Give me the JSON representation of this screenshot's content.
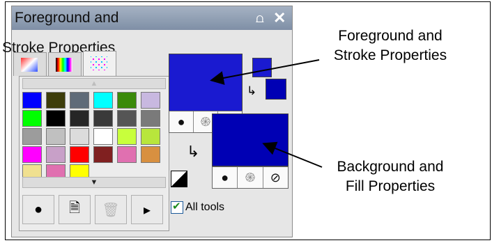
{
  "panel": {
    "title": "Foreground and",
    "title_cont": "Stroke Properties",
    "pin_glyph": "⩍",
    "close_glyph": "✕"
  },
  "palette": {
    "swatches": [
      "#0000ff",
      "#3d3d0a",
      "#5f6b78",
      "#00ffff",
      "#3b8a0a",
      "#c8b8e0",
      "#00ff00",
      "#000000",
      "#262626",
      "#3a3a3a",
      "#555555",
      "#7a7a7a",
      "#9c9c9c",
      "#c0c0c0",
      "#dcdcdc",
      "#ffffff",
      "#c8ff3c",
      "#b8e63c",
      "#ff00ff",
      "#c8a0c8",
      "#ff0000",
      "#802020",
      "#e070b0",
      "#d89040",
      "#f0e090",
      "#e070b0",
      "#ffff00"
    ]
  },
  "colors": {
    "foreground": "#1a1ad0",
    "background": "#0000b4"
  },
  "swap_glyph": "↳",
  "checkbox": {
    "label": "All tools",
    "checked": true
  },
  "annotations": {
    "fg_line1": "Foreground and",
    "fg_line2": "Stroke Properties",
    "bg_line1": "Background and",
    "bg_line2": "Fill Properties"
  }
}
